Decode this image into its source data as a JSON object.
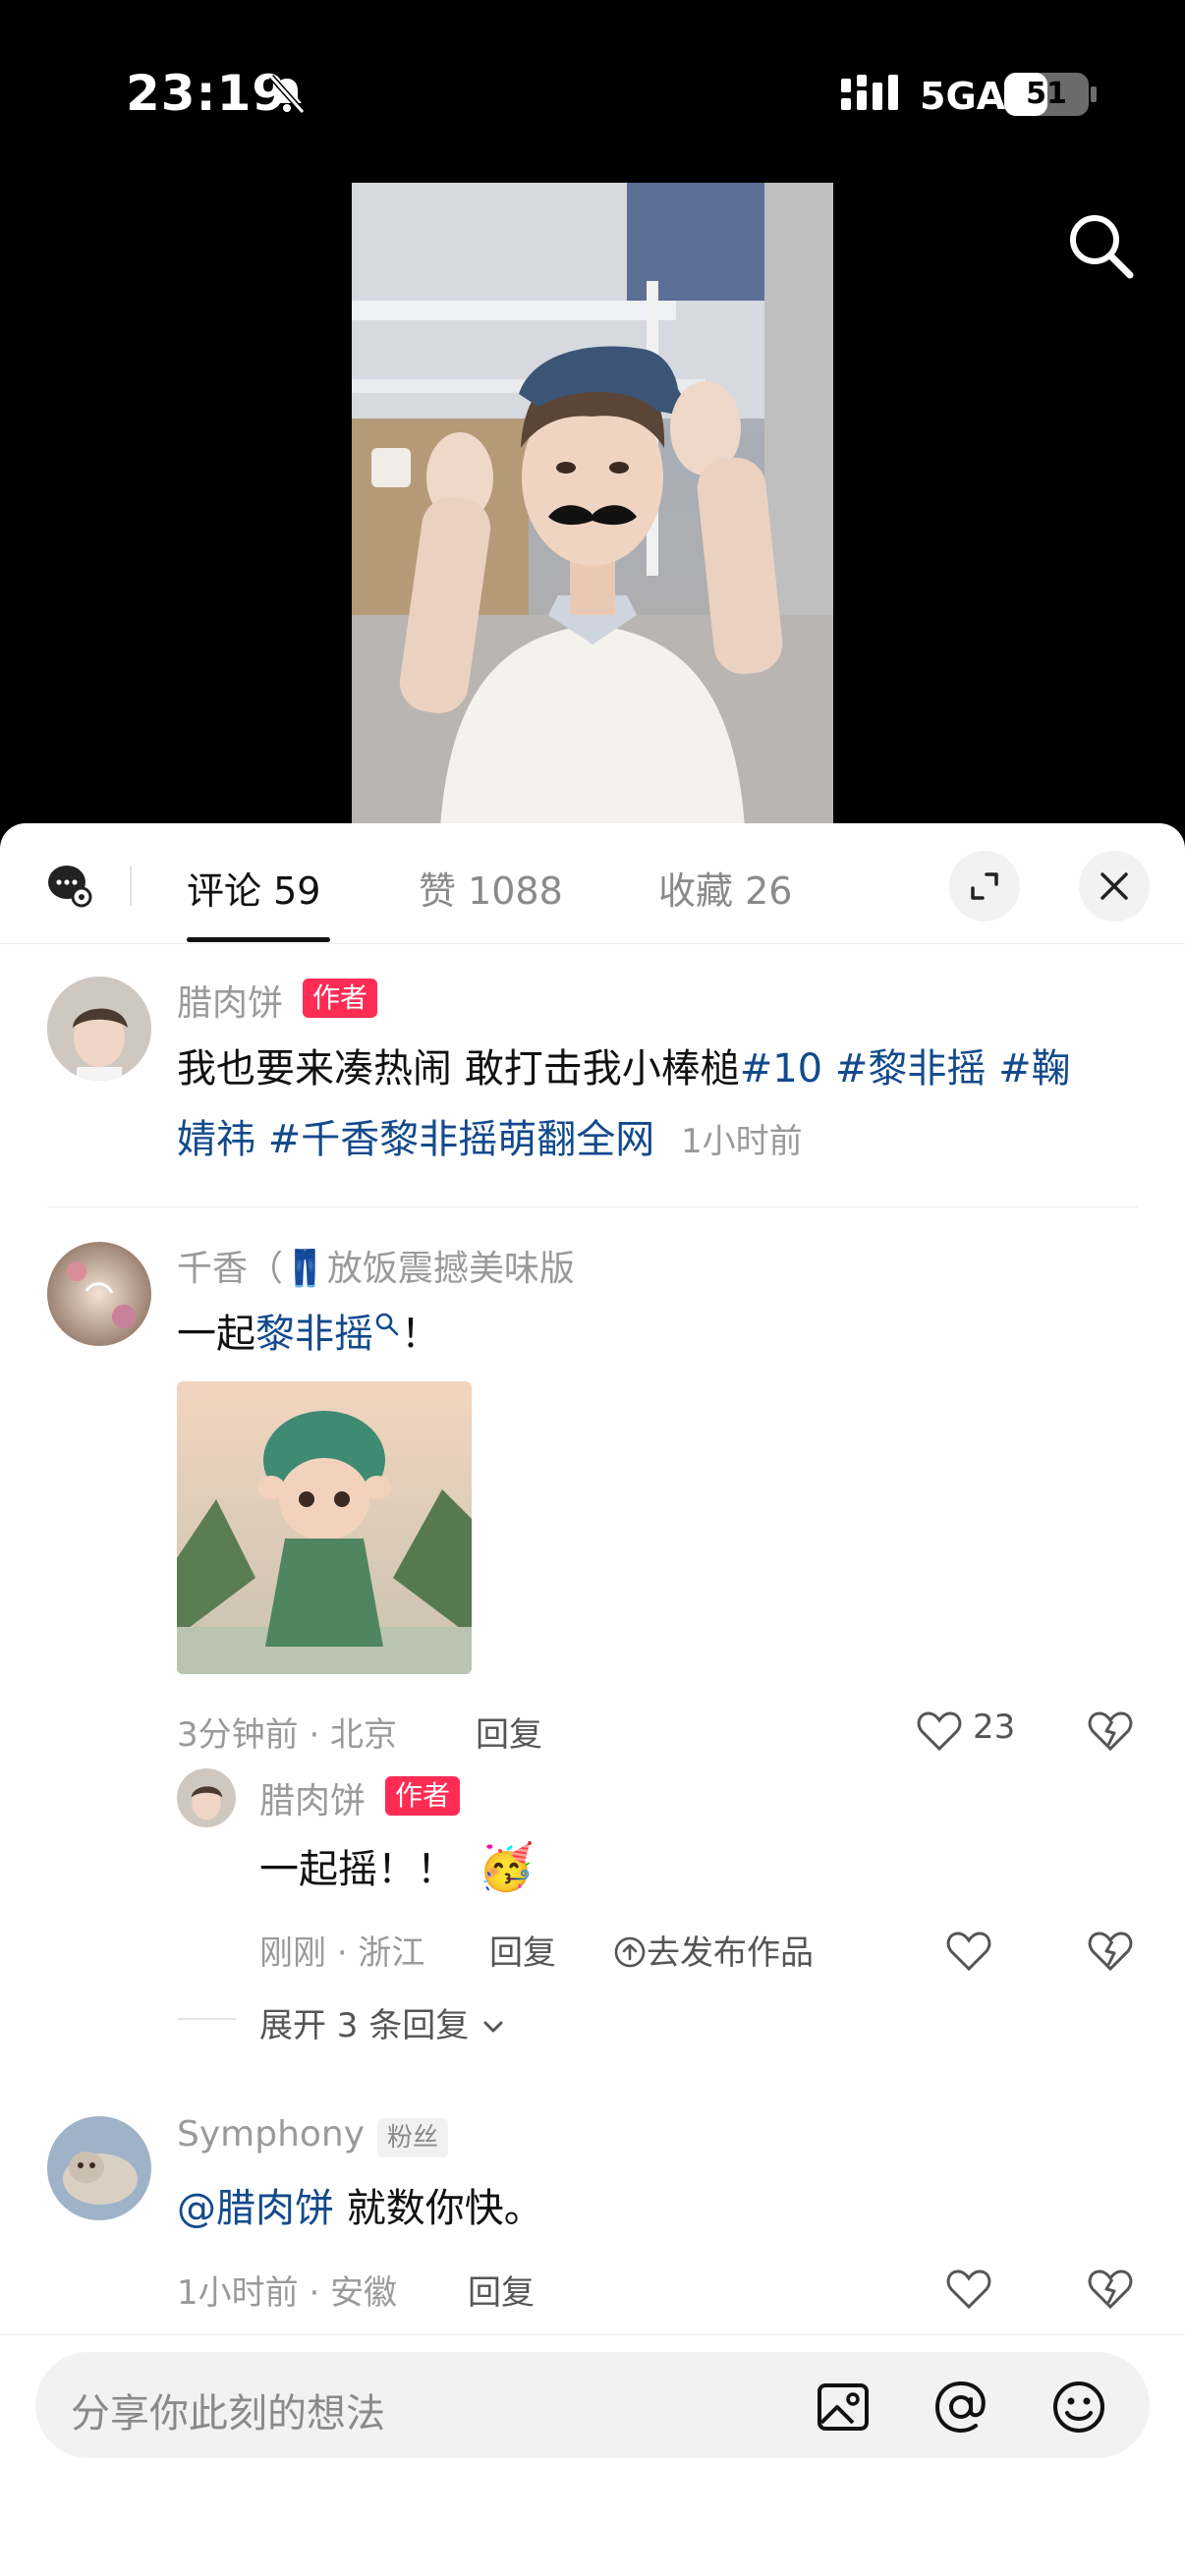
{
  "status_bar": {
    "time": "23:19",
    "network": "5GA",
    "battery": "51",
    "battery_level": 0.51,
    "icons": [
      "bell-slash-icon",
      "signal-icon",
      "battery-icon"
    ]
  },
  "video": {
    "search_icon": "search-icon"
  },
  "comments_panel": {
    "tabs": [
      {
        "label": "评论 59",
        "active": true
      },
      {
        "label": "赞 1088",
        "active": false
      },
      {
        "label": "收藏 26",
        "active": false
      }
    ],
    "icons": [
      "comment-settings-icon",
      "expand-icon",
      "close-icon"
    ],
    "comments": [
      {
        "user": "腊肉饼",
        "badge": "作者",
        "text_plain": "我也要来凑热闹 敢打击我小棒槌",
        "tags_line1": "#10 #黎非摇 #鞠",
        "tags_line2": "婧祎 #千香黎非摇萌翻全网",
        "time": "1小时前"
      },
      {
        "user": "千香（👖放饭震撼美味版",
        "text_prefix": "一起",
        "text_link": "黎非摇",
        "text_suffix": "！",
        "meta": "3分钟前 · 北京",
        "reply_label": "回复",
        "likes": "23",
        "reply": {
          "user": "腊肉饼",
          "badge": "作者",
          "text": "一起摇！！",
          "emoji": "🥳",
          "meta": "刚刚 · 浙江",
          "reply_label": "回复",
          "publish_label": "去发布作品"
        },
        "expand_label": "展开 3 条回复"
      },
      {
        "user": "Symphony",
        "badge": "粉丝",
        "mention": "@腊肉饼",
        "text": " 就数你快。",
        "meta": "1小时前 · 安徽",
        "reply_label": "回复"
      }
    ],
    "input": {
      "placeholder": "分享你此刻的想法",
      "icons": [
        "image-icon",
        "at-icon",
        "emoji-icon"
      ]
    }
  },
  "colors": {
    "accent_red": "#fe2c55",
    "link_blue": "#134a8c"
  }
}
